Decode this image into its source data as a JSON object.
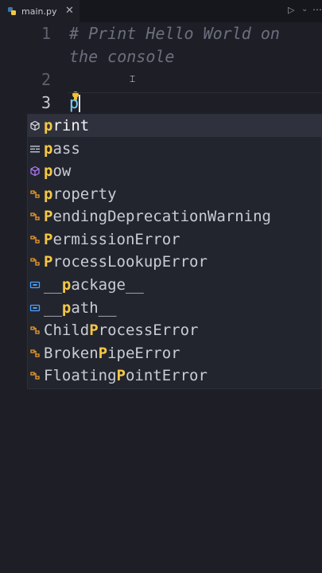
{
  "tab": {
    "filename": "main.py",
    "close": "✕"
  },
  "toolbar": {
    "run": "▷",
    "run_menu": "⌄",
    "more": "⋯"
  },
  "editor": {
    "lines": [
      {
        "number": "1",
        "text_a": "# Print Hello World on",
        "text_b": "the console"
      },
      {
        "number": "2"
      },
      {
        "number": "3",
        "typed": "p"
      }
    ]
  },
  "suggestions": [
    {
      "pre": "",
      "match": "p",
      "post": "rint",
      "icon": "cube-icon"
    },
    {
      "pre": "",
      "match": "p",
      "post": "ass",
      "icon": "keyword-icon"
    },
    {
      "pre": "",
      "match": "p",
      "post": "ow",
      "icon": "cube-icon"
    },
    {
      "pre": "",
      "match": "p",
      "post": "roperty",
      "icon": "class-icon"
    },
    {
      "pre": "",
      "match": "P",
      "post": "endingDeprecationWarning",
      "icon": "class-icon"
    },
    {
      "pre": "",
      "match": "P",
      "post": "ermissionError",
      "icon": "class-icon"
    },
    {
      "pre": "",
      "match": "P",
      "post": "rocessLookupError",
      "icon": "class-icon"
    },
    {
      "pre": "__",
      "match": "p",
      "post": "ackage__",
      "icon": "variable-icon"
    },
    {
      "pre": "__",
      "match": "p",
      "post": "ath__",
      "icon": "variable-icon"
    },
    {
      "pre": "Child",
      "match": "P",
      "post": "rocessError",
      "icon": "class-icon"
    },
    {
      "pre": "Broken",
      "match": "P",
      "post": "ipeError",
      "icon": "class-icon"
    },
    {
      "pre": "Floating",
      "match": "P",
      "post": "ointError",
      "icon": "class-icon"
    }
  ]
}
